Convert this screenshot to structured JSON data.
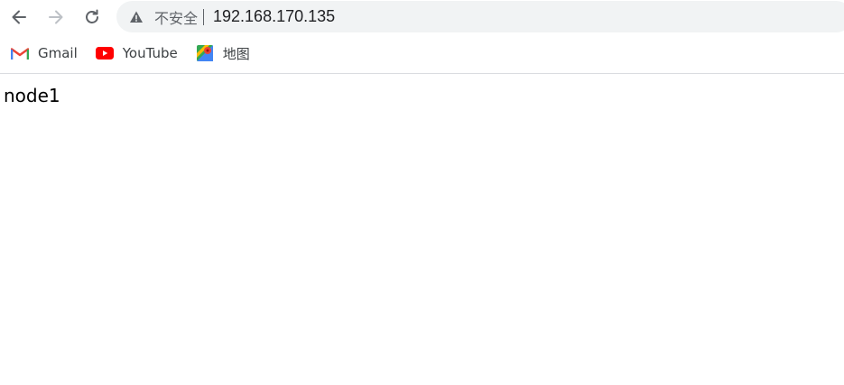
{
  "browser": {
    "omnibox": {
      "security_label": "不安全",
      "url": "192.168.170.135"
    },
    "icons": {
      "back": "arrow-left-icon",
      "forward": "arrow-right-icon",
      "reload": "reload-icon",
      "warning": "warning-triangle-icon"
    },
    "bookmarks": [
      {
        "label": "Gmail",
        "icon": "gmail-icon"
      },
      {
        "label": "YouTube",
        "icon": "youtube-icon"
      },
      {
        "label": "地图",
        "icon": "maps-icon"
      }
    ]
  },
  "page": {
    "body_text": "node1"
  },
  "colors": {
    "omnibox_bg": "#f1f3f4",
    "youtube_red": "#ff0000",
    "gmail_red": "#ea4335"
  }
}
